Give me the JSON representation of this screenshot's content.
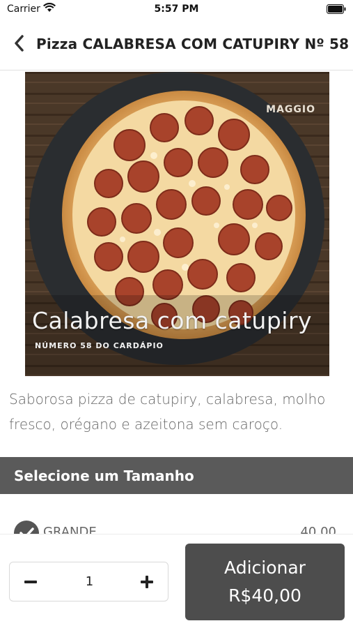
{
  "status_bar": {
    "carrier": "Carrier",
    "time": "5:57 PM"
  },
  "nav": {
    "title": "Pizza CALABRESA COM CATUPIRY Nº 58",
    "back_icon": "chevron-left-icon"
  },
  "product_image": {
    "caption": "Calabresa com catupiry",
    "subcaption": "NÚMERO 58 DO CARDÁPIO",
    "logo_text": "MAGGIO"
  },
  "product": {
    "description": "Saborosa pizza de catupiry, calabresa, molho fresco, orégano e azeitona sem caroço."
  },
  "size_section": {
    "title": "Selecione um Tamanho",
    "options": [
      {
        "name": "GRANDE",
        "price": "40,00",
        "selected": true
      }
    ]
  },
  "cart": {
    "quantity": "1",
    "add_label": "Adicionar",
    "add_price": "R$40,00"
  },
  "colors": {
    "section_header_bg": "#5a5a5a",
    "add_button_bg": "#4d4d4d",
    "text_secondary": "#666666"
  }
}
